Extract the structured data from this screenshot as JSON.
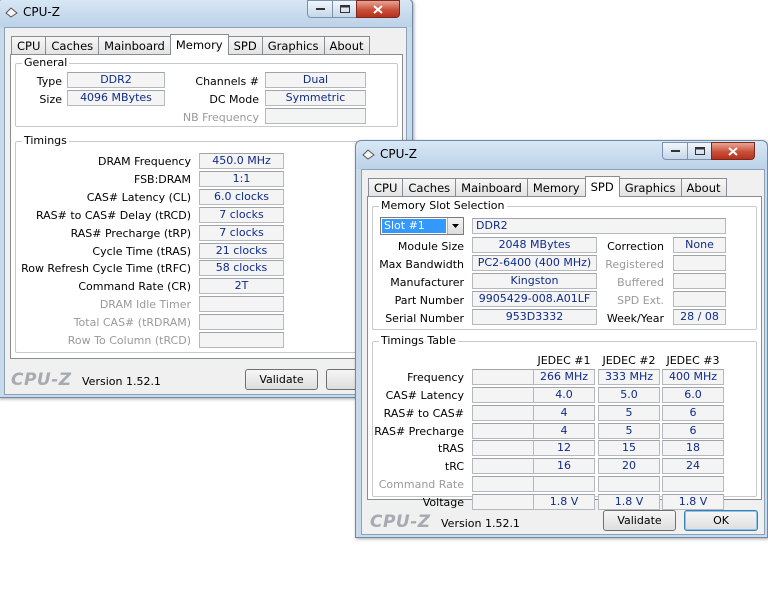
{
  "colors": {
    "value_text": "#0f2b8a",
    "title_bg": "#c9dbeb",
    "close_red": "#c9503a"
  },
  "window1": {
    "title": "CPU-Z",
    "tabs": [
      "CPU",
      "Caches",
      "Mainboard",
      "Memory",
      "SPD",
      "Graphics",
      "About"
    ],
    "active_tab": "Memory",
    "general": {
      "group_title": "General",
      "type_label": "Type",
      "type_value": "DDR2",
      "size_label": "Size",
      "size_value": "4096 MBytes",
      "channels_label": "Channels #",
      "channels_value": "Dual",
      "dcmode_label": "DC Mode",
      "dcmode_value": "Symmetric",
      "nbfreq_label": "NB Frequency",
      "nbfreq_value": ""
    },
    "timings": {
      "group_title": "Timings",
      "rows": [
        {
          "label": "DRAM Frequency",
          "value": "450.0 MHz",
          "dim": false
        },
        {
          "label": "FSB:DRAM",
          "value": "1:1",
          "dim": false
        },
        {
          "label": "CAS# Latency (CL)",
          "value": "6.0 clocks",
          "dim": false
        },
        {
          "label": "RAS# to CAS# Delay (tRCD)",
          "value": "7 clocks",
          "dim": false
        },
        {
          "label": "RAS# Precharge (tRP)",
          "value": "7 clocks",
          "dim": false
        },
        {
          "label": "Cycle Time (tRAS)",
          "value": "21 clocks",
          "dim": false
        },
        {
          "label": "Row Refresh Cycle Time (tRFC)",
          "value": "58 clocks",
          "dim": false
        },
        {
          "label": "Command Rate (CR)",
          "value": "2T",
          "dim": false
        },
        {
          "label": "DRAM Idle Timer",
          "value": "",
          "dim": true
        },
        {
          "label": "Total CAS# (tRDRAM)",
          "value": "",
          "dim": true
        },
        {
          "label": "Row To Column (tRCD)",
          "value": "",
          "dim": true
        }
      ]
    },
    "footer": {
      "logo": "CPU-Z",
      "version": "Version 1.52.1",
      "validate": "Validate"
    }
  },
  "window2": {
    "title": "CPU-Z",
    "tabs": [
      "CPU",
      "Caches",
      "Mainboard",
      "Memory",
      "SPD",
      "Graphics",
      "About"
    ],
    "active_tab": "SPD",
    "slot": {
      "group_title": "Memory Slot Selection",
      "selected_slot": "Slot #1",
      "slot_type": "DDR2",
      "module_size_label": "Module Size",
      "module_size": "2048 MBytes",
      "max_bandwidth_label": "Max Bandwidth",
      "max_bandwidth": "PC2-6400 (400 MHz)",
      "manufacturer_label": "Manufacturer",
      "manufacturer": "Kingston",
      "part_number_label": "Part Number",
      "part_number": "9905429-008.A01LF",
      "serial_number_label": "Serial Number",
      "serial_number": "953D3332",
      "correction_label": "Correction",
      "correction": "None",
      "registered_label": "Registered",
      "registered": "",
      "buffered_label": "Buffered",
      "buffered": "",
      "spd_ext_label": "SPD Ext.",
      "spd_ext": "",
      "week_year_label": "Week/Year",
      "week_year": "28 / 08"
    },
    "timings_table": {
      "group_title": "Timings Table",
      "columns": [
        "JEDEC #1",
        "JEDEC #2",
        "JEDEC #3"
      ],
      "rows": [
        {
          "label": "Frequency",
          "values": [
            "266 MHz",
            "333 MHz",
            "400 MHz"
          ],
          "dim": false
        },
        {
          "label": "CAS# Latency",
          "values": [
            "4.0",
            "5.0",
            "6.0"
          ],
          "dim": false
        },
        {
          "label": "RAS# to CAS#",
          "values": [
            "4",
            "5",
            "6"
          ],
          "dim": false
        },
        {
          "label": "RAS# Precharge",
          "values": [
            "4",
            "5",
            "6"
          ],
          "dim": false
        },
        {
          "label": "tRAS",
          "values": [
            "12",
            "15",
            "18"
          ],
          "dim": false
        },
        {
          "label": "tRC",
          "values": [
            "16",
            "20",
            "24"
          ],
          "dim": false
        },
        {
          "label": "Command Rate",
          "values": [
            "",
            "",
            ""
          ],
          "dim": true
        },
        {
          "label": "Voltage",
          "values": [
            "1.8 V",
            "1.8 V",
            "1.8 V"
          ],
          "dim": false
        }
      ]
    },
    "footer": {
      "logo": "CPU-Z",
      "version": "Version 1.52.1",
      "validate": "Validate",
      "ok": "OK"
    }
  }
}
